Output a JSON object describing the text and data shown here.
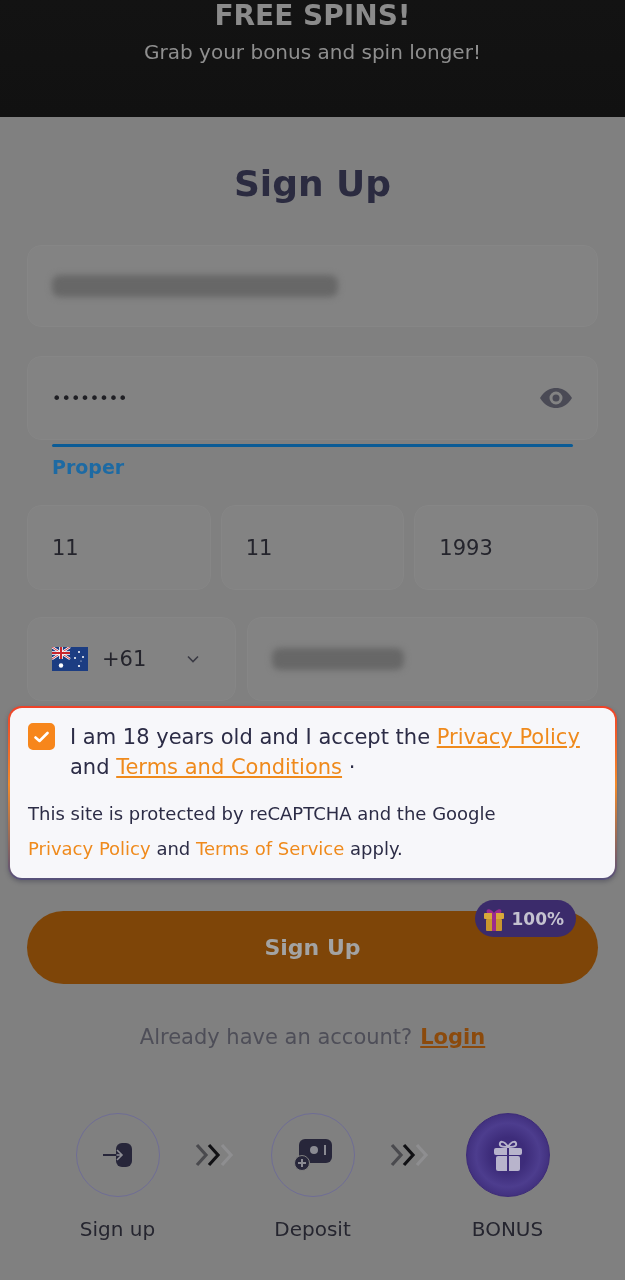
{
  "banner": {
    "title": "FREE SPINS!",
    "subtitle": "Grab your bonus and spin longer!"
  },
  "heading": "Sign Up",
  "email": {
    "value_hidden": true
  },
  "password": {
    "value": "••••••••",
    "focused": true,
    "strength_label": "Proper"
  },
  "birth_date": [
    {
      "value": "11"
    },
    {
      "value": "11"
    },
    {
      "value": "1993"
    }
  ],
  "phone": {
    "country_code": "+61",
    "value_hidden": true
  },
  "consent": {
    "checked": true,
    "parts": [
      {
        "kind": "text",
        "text": "I am 18 years old and I accept the "
      },
      {
        "kind": "link",
        "text": "Privacy Policy"
      },
      {
        "kind": "text",
        "text": " and "
      },
      {
        "kind": "link",
        "text": "Terms and Conditions"
      },
      {
        "kind": "text",
        "text": " ·"
      }
    ]
  },
  "recaptcha_note": {
    "parts": [
      {
        "kind": "text",
        "text": "This site is protected by reCAPTCHA and the Google "
      },
      {
        "kind": "link",
        "text": "Privacy Policy"
      },
      {
        "kind": "text",
        "text": " and "
      },
      {
        "kind": "link",
        "text": "Terms of Service"
      },
      {
        "kind": "text",
        "text": " apply."
      }
    ]
  },
  "signup_button": {
    "label": "Sign Up",
    "badge": "100%"
  },
  "login_prompt": {
    "text": "Already have an account?",
    "link": "Login"
  },
  "steps": [
    {
      "kind": "enter",
      "label": "Sign up",
      "highlighted": false
    },
    {
      "kind": "deposit",
      "label": "Deposit",
      "highlighted": false
    },
    {
      "kind": "gift",
      "label": "BONUS",
      "highlighted": true
    }
  ]
}
